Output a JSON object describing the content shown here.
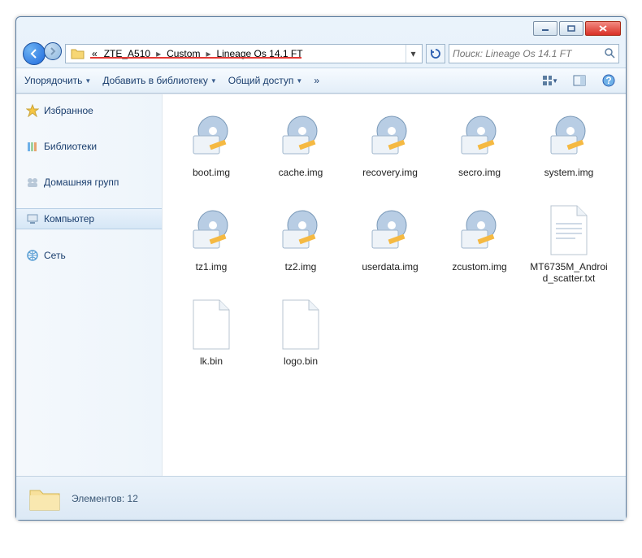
{
  "titlebar": {},
  "breadcrumb": {
    "prefix": "«",
    "segments": [
      "ZTE_A510",
      "Custom",
      "Lineage Os 14.1 FT"
    ]
  },
  "search": {
    "placeholder": "Поиск: Lineage Os 14.1 FT"
  },
  "toolbar": {
    "organize": "Упорядочить",
    "library": "Добавить в библиотеку",
    "share": "Общий доступ",
    "overflow": "»"
  },
  "sidebar": {
    "favorites": "Избранное",
    "libraries": "Библиотеки",
    "homegroup": "Домашняя групп",
    "computer": "Компьютер",
    "network": "Сеть"
  },
  "files": [
    {
      "name": "boot.img",
      "type": "img"
    },
    {
      "name": "cache.img",
      "type": "img"
    },
    {
      "name": "recovery.img",
      "type": "img"
    },
    {
      "name": "secro.img",
      "type": "img"
    },
    {
      "name": "system.img",
      "type": "img"
    },
    {
      "name": "tz1.img",
      "type": "img"
    },
    {
      "name": "tz2.img",
      "type": "img"
    },
    {
      "name": "userdata.img",
      "type": "img"
    },
    {
      "name": "zcustom.img",
      "type": "img"
    },
    {
      "name": "MT6735M_Android_scatter.txt",
      "type": "txt"
    },
    {
      "name": "lk.bin",
      "type": "bin"
    },
    {
      "name": "logo.bin",
      "type": "bin"
    }
  ],
  "statusbar": {
    "count_label": "Элементов: 12"
  }
}
